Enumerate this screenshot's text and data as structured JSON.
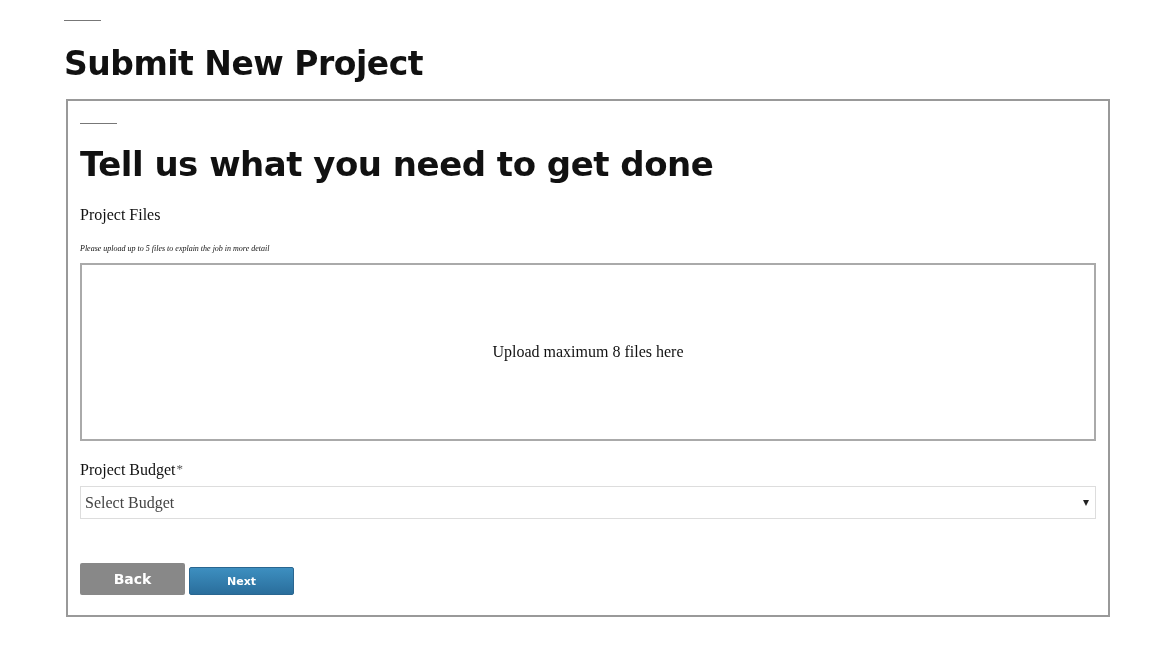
{
  "page_title": "Submit New Project",
  "card": {
    "heading": "Tell us what you need to get done",
    "files": {
      "label": "Project Files",
      "hint": "Please upload up to 5 files to explain the job in more detail",
      "dropzone_text": "Upload maximum 8 files here"
    },
    "budget": {
      "label": "Project Budget",
      "required_mark": "*",
      "placeholder": "Select Budget",
      "arrow": "▾"
    },
    "buttons": [
      {
        "label": "Back",
        "kind": "secondary"
      },
      {
        "label": "Next",
        "kind": "primary"
      }
    ]
  }
}
